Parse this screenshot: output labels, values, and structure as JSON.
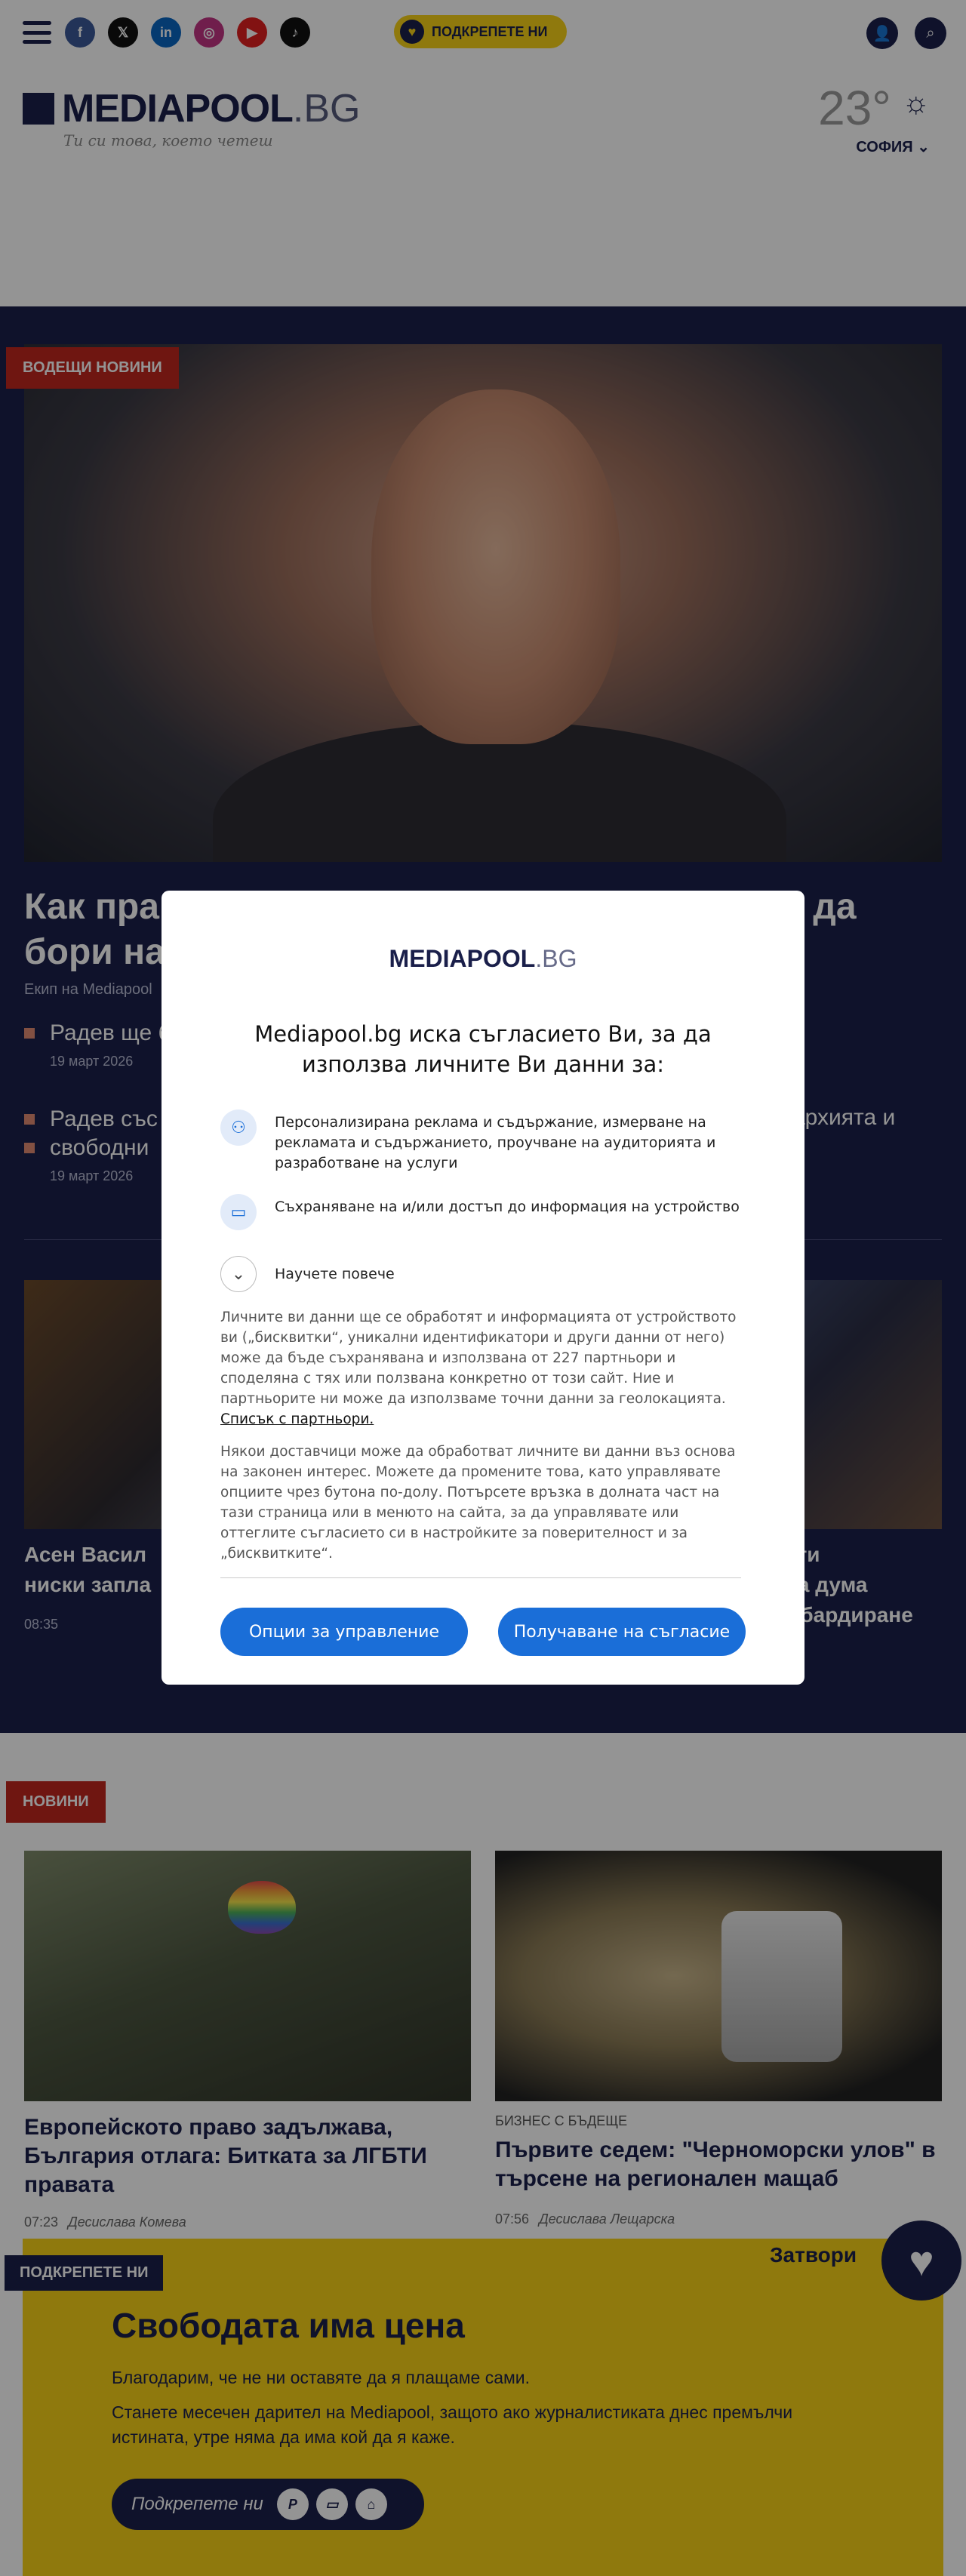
{
  "header": {
    "support_label": "ПОДКРЕПЕТЕ НИ",
    "social": [
      {
        "name": "facebook",
        "glyph": "f",
        "color": "#3b5998"
      },
      {
        "name": "x",
        "glyph": "𝕏",
        "color": "#111111"
      },
      {
        "name": "linkedin",
        "glyph": "in",
        "color": "#0a66c2"
      },
      {
        "name": "instagram",
        "glyph": "◎",
        "color": "#c13584"
      },
      {
        "name": "youtube",
        "glyph": "▶",
        "color": "#e02020"
      },
      {
        "name": "tiktok",
        "glyph": "♪",
        "color": "#111111"
      }
    ]
  },
  "brand": {
    "name": "MEDIAPOOL",
    "tld": ".BG",
    "tagline": "Ти си това, което четеш"
  },
  "weather": {
    "temp": "23°",
    "city": "СОФИЯ"
  },
  "lead": {
    "tag": "ВОДЕЩИ НОВИНИ",
    "title": "Как правителството на Радев ще се опитва да бори нагласен",
    "author": "Екип на Mediapool",
    "related": [
      {
        "title": "Радев ще б",
        "date": "19 март 2026"
      },
      {
        "title": "Радев със",
        "title_tail": "архията и",
        "title2": "свободни",
        "date": "19 март 2026"
      }
    ],
    "subs": [
      {
        "title": "Асен Васил",
        "title2": "ниски запла",
        "date": "08:35"
      },
      {
        "title": "ати",
        "title2": "на дума",
        "title3": "мбардиране"
      }
    ]
  },
  "news": {
    "tag": "НОВИНИ",
    "cards": [
      {
        "category": "",
        "title": "Европейското право задължава, България отлага: Битката за ЛГБТИ правата",
        "time": "07:23",
        "author": "Десислава Комева"
      },
      {
        "category": "БИЗНЕС С БЪДЕЩЕ",
        "title": "Първите седем: \"Черноморски улов\" в търсене на регионален мащаб",
        "time": "07:56",
        "author": "Десислава Лещарска"
      }
    ]
  },
  "support_banner": {
    "tag": "ПОДКРЕПЕТЕ НИ",
    "close": "Затвори",
    "title": "Свободата има цена",
    "p1": "Благодарим, че не ни оставяте да я плащаме сами.",
    "p2": "Станете месечен дарител на Mediapool, защото ако журналистиката днес премълчи истината, утре няма да има кой да я каже.",
    "button": "Подкрепете ни"
  },
  "consent": {
    "logo_name": "MEDIAPOOL",
    "logo_tld": ".BG",
    "heading": "Mediapool.bg иска съгласието Ви, за да използва личните Ви данни за:",
    "purpose1": "Персонализирана реклама и съдържание, измерване на рекламата и съдържанието, проучване на аудиторията и разработване на услуги",
    "purpose2": "Съхраняване на и/или достъп до информация на устройство",
    "learn_more": "Научете повече",
    "para1": "Личните ви данни ще се обработят и информацията от устройството ви („бисквитки“, уникални идентификатори и други данни от него) може да бъде съхранявана и използвана от 227 партньори и споделяна с тях или ползвана конкретно от този сайт. Ние и партньорите ни може да използваме точни данни за геолокацията.",
    "partners_link": "Списък с партньори.",
    "para2": "Някои доставчици може да обработват личните ви данни въз основа на законен интерес. Можете да промените това, като управлявате опциите чрез бутона по-долу. Потърсете връзка в долната част на тази страница или в менюто на сайта, за да управлявате или оттеглите съгласието си в настройките за поверителност и за „бисквитките“.",
    "manage_button": "Опции за управление",
    "consent_button": "Получаване на съгласие"
  }
}
